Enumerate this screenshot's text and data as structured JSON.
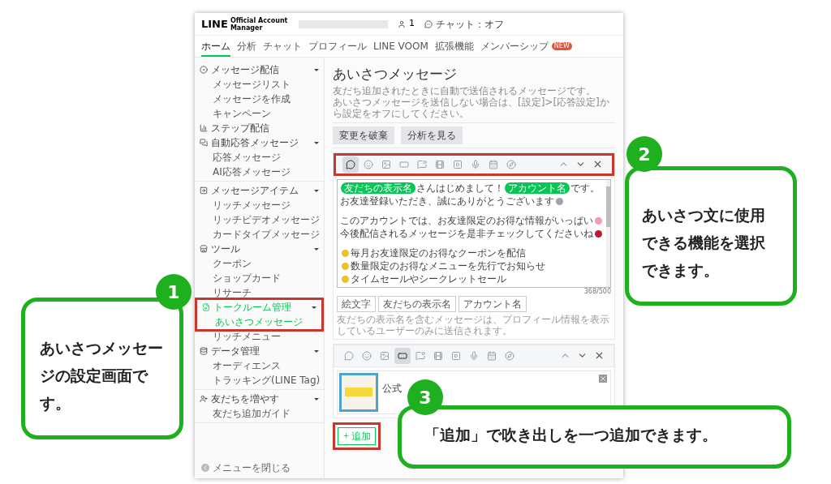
{
  "header": {
    "logo": "LINE",
    "logo_sub": "Official Account Manager",
    "friends": "1",
    "chat_status": "チャット：オフ"
  },
  "tabs": [
    {
      "label": "ホーム",
      "selected": true
    },
    {
      "label": "分析",
      "selected": false
    },
    {
      "label": "チャット",
      "selected": false
    },
    {
      "label": "プロフィール",
      "selected": false
    },
    {
      "label": "LINE VOOM",
      "selected": false
    },
    {
      "label": "拡張機能",
      "selected": false
    },
    {
      "label": "メンバーシップ",
      "selected": false,
      "badge": "NEW"
    }
  ],
  "sidebar": {
    "sections": [
      {
        "groups": [
          {
            "label": "メッセージ配信",
            "highlighted": false,
            "children": [
              {
                "label": "メッセージリスト",
                "selected": false
              },
              {
                "label": "メッセージを作成",
                "selected": false
              },
              {
                "label": "キャンペーン",
                "selected": false
              }
            ]
          },
          {
            "label": "ステップ配信",
            "highlighted": false
          },
          {
            "label": "自動応答メッセージ",
            "highlighted": false,
            "children": [
              {
                "label": "応答メッセージ",
                "selected": false
              },
              {
                "label": "AI応答メッセージ",
                "selected": false
              }
            ]
          }
        ]
      },
      {
        "groups": [
          {
            "label": "メッセージアイテム",
            "highlighted": false,
            "children": [
              {
                "label": "リッチメッセージ",
                "selected": false
              },
              {
                "label": "リッチビデオメッセージ",
                "selected": false
              },
              {
                "label": "カードタイプメッセージ",
                "selected": false
              }
            ]
          },
          {
            "label": "ツール",
            "highlighted": false,
            "children": [
              {
                "label": "クーポン",
                "selected": false
              },
              {
                "label": "ショップカード",
                "selected": false
              },
              {
                "label": "リサーチ",
                "selected": false
              }
            ]
          },
          {
            "label": "トークルーム管理",
            "highlighted": true,
            "children": [
              {
                "label": "あいさつメッセージ",
                "selected": true
              },
              {
                "label": "リッチメニュー",
                "selected": false
              }
            ]
          },
          {
            "label": "データ管理",
            "highlighted": false,
            "children": [
              {
                "label": "オーディエンス",
                "selected": false
              },
              {
                "label": "トラッキング(LINE Tag)",
                "selected": false
              }
            ]
          }
        ]
      },
      {
        "groups": [
          {
            "label": "友だちを増やす",
            "highlighted": false,
            "children": [
              {
                "label": "友だち追加ガイド",
                "selected": false
              }
            ]
          }
        ]
      }
    ],
    "collapse": "メニューを閉じる"
  },
  "main": {
    "title": "あいさつメッセージ",
    "description": [
      "友だち追加されたときに自動で送信されるメッセージです。",
      "あいさつメッセージを送信しない場合は、[設定]>[応答設定]から設定をオフにしてください。"
    ],
    "buttons": [
      "変更を破棄",
      "分析を見る"
    ],
    "bubbles": [
      {
        "kind": "text",
        "toolbar_highlighted": true,
        "tools": [
          {
            "selected": true
          },
          {
            "selected": false
          },
          {
            "selected": false
          },
          {
            "selected": false
          },
          {
            "selected": false
          },
          {
            "selected": false
          },
          {
            "selected": false
          },
          {
            "selected": false
          },
          {
            "selected": false
          },
          {
            "selected": false
          }
        ],
        "lines": [
          {
            "kind": "text",
            "segments": [
              {
                "kind": "tag",
                "text": "友だちの表示名"
              },
              {
                "kind": "text",
                "text": "さんはじめまして！"
              },
              {
                "kind": "tag",
                "text": "アカウント名"
              },
              {
                "kind": "text",
                "text": "です。"
              }
            ]
          },
          {
            "kind": "text",
            "segments": [
              {
                "kind": "text",
                "text": "お友達登録いただき、誠にありがとうございます"
              },
              {
                "kind": "emoji",
                "color": "#9ca3af"
              }
            ]
          },
          {
            "kind": "blank"
          },
          {
            "kind": "text",
            "segments": [
              {
                "kind": "text",
                "text": "このアカウントでは、お友達限定のお得な情報がいっぱい"
              },
              {
                "kind": "emoji",
                "color": "#f19cb0"
              }
            ]
          },
          {
            "kind": "text",
            "segments": [
              {
                "kind": "text",
                "text": "今後配信されるメッセージを是非チェックしてくださいね"
              },
              {
                "kind": "emoji",
                "color": "#c0182a"
              }
            ]
          },
          {
            "kind": "blank"
          },
          {
            "kind": "text",
            "segments": [
              {
                "kind": "emoji",
                "color": "#e8c12f"
              },
              {
                "kind": "text",
                "text": "毎月お友達限定のお得なクーポンを配信"
              }
            ]
          },
          {
            "kind": "text",
            "segments": [
              {
                "kind": "emoji",
                "color": "#e8c12f"
              },
              {
                "kind": "text",
                "text": "数量限定のお得なメニューを先行でお知らせ"
              }
            ]
          },
          {
            "kind": "text",
            "segments": [
              {
                "kind": "emoji",
                "color": "#e8c12f"
              },
              {
                "kind": "text",
                "text": "タイムセールやシークレットセール"
              }
            ]
          }
        ],
        "counter": "368/500",
        "inserts": [
          "絵文字",
          "友だちの表示名",
          "アカウント名"
        ],
        "hint": "友だちの表示名を含むメッセージは、プロフィール情報を表示しているユーザーのみに送信されます。"
      },
      {
        "kind": "card",
        "toolbar_highlighted": false,
        "tools": [
          {
            "selected": false
          },
          {
            "selected": false
          },
          {
            "selected": false
          },
          {
            "selected": true
          },
          {
            "selected": false
          },
          {
            "selected": false
          },
          {
            "selected": false
          },
          {
            "selected": false
          },
          {
            "selected": false
          },
          {
            "selected": false
          }
        ],
        "card_title": "公式"
      }
    ],
    "add_button": {
      "label": "追加",
      "highlighted": true
    }
  },
  "callouts": [
    {
      "number": "1",
      "text": "あいさつメッセージの設定画面です。"
    },
    {
      "number": "2",
      "text": "あいさつ文に使用できる機能を選択できます。"
    },
    {
      "number": "3",
      "text": "「追加」で吹き出しを一つ追加できます。"
    }
  ]
}
